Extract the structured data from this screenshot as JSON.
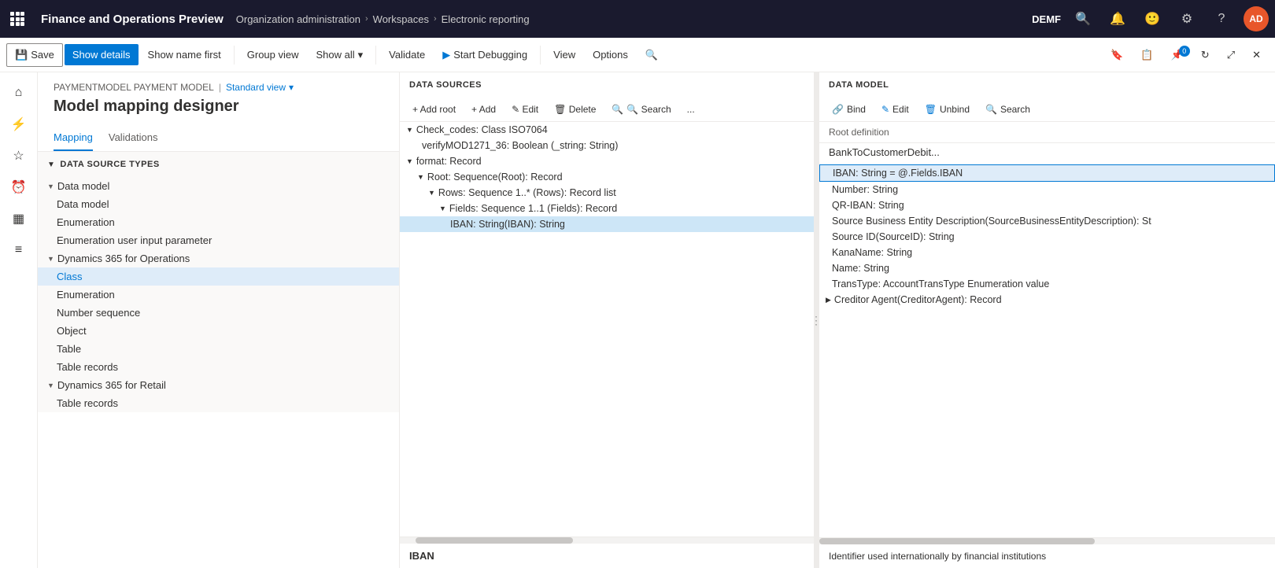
{
  "topnav": {
    "app_title": "Finance and Operations Preview",
    "breadcrumb": [
      "Organization administration",
      "Workspaces",
      "Electronic reporting"
    ],
    "env": "DEMF",
    "user_initials": "AD"
  },
  "toolbar": {
    "save_label": "Save",
    "show_details_label": "Show details",
    "show_name_first_label": "Show name first",
    "group_view_label": "Group view",
    "show_all_label": "Show all",
    "validate_label": "Validate",
    "start_debugging_label": "Start Debugging",
    "view_label": "View",
    "options_label": "Options"
  },
  "page": {
    "breadcrumb1": "PAYMENTMODEL PAYMENT MODEL",
    "breadcrumb_separator": "|",
    "standard_view": "Standard view",
    "title": "Model mapping designer"
  },
  "tabs": {
    "items": [
      "Mapping",
      "Validations"
    ]
  },
  "dst_panel": {
    "header": "DATA SOURCE TYPES",
    "items": [
      {
        "label": "Data model",
        "level": 0,
        "collapsed": false,
        "type": "parent"
      },
      {
        "label": "Data model",
        "level": 1,
        "type": "leaf"
      },
      {
        "label": "Enumeration",
        "level": 1,
        "type": "leaf"
      },
      {
        "label": "Enumeration user input parameter",
        "level": 1,
        "type": "leaf"
      },
      {
        "label": "Dynamics 365 for Operations",
        "level": 0,
        "collapsed": false,
        "type": "parent"
      },
      {
        "label": "Class",
        "level": 1,
        "type": "leaf",
        "selected": true
      },
      {
        "label": "Enumeration",
        "level": 1,
        "type": "leaf"
      },
      {
        "label": "Number sequence",
        "level": 1,
        "type": "leaf"
      },
      {
        "label": "Object",
        "level": 1,
        "type": "leaf"
      },
      {
        "label": "Table",
        "level": 1,
        "type": "leaf"
      },
      {
        "label": "Table records",
        "level": 1,
        "type": "leaf"
      },
      {
        "label": "Dynamics 365 for Retail",
        "level": 0,
        "collapsed": false,
        "type": "parent"
      },
      {
        "label": "Table records",
        "level": 1,
        "type": "leaf"
      }
    ]
  },
  "ds_panel": {
    "header": "DATA SOURCES",
    "toolbar": {
      "add_root": "+ Add root",
      "add": "+ Add",
      "edit": "✎ Edit",
      "delete": "🗑 Delete",
      "search": "🔍 Search",
      "more": "..."
    },
    "items": [
      {
        "label": "Check_codes: Class ISO7064",
        "level": 0,
        "collapsed": false,
        "arrow": "▼"
      },
      {
        "label": "verifyMOD1271_36: Boolean (_string: String)",
        "level": 1
      },
      {
        "label": "format: Record",
        "level": 0,
        "collapsed": false,
        "arrow": "▼"
      },
      {
        "label": "Root: Sequence(Root): Record",
        "level": 1,
        "collapsed": false,
        "arrow": "▼"
      },
      {
        "label": "Rows: Sequence 1..* (Rows): Record list",
        "level": 2,
        "collapsed": false,
        "arrow": "▼"
      },
      {
        "label": "Fields: Sequence 1..1 (Fields): Record",
        "level": 3,
        "collapsed": false,
        "arrow": "▼"
      },
      {
        "label": "IBAN: String(IBAN): String",
        "level": 4,
        "selected": true
      }
    ],
    "footer": "IBAN"
  },
  "dm_panel": {
    "header": "DATA MODEL",
    "toolbar": {
      "bind": "Bind",
      "edit": "Edit",
      "unbind": "Unbind",
      "search": "Search"
    },
    "root_def_label": "Root definition",
    "root_def_value": "BankToCustomerDebit...",
    "items": [
      {
        "label": "IBAN: String = @.Fields.IBAN",
        "level": 0,
        "selected": true
      },
      {
        "label": "Number: String",
        "level": 0
      },
      {
        "label": "QR-IBAN: String",
        "level": 0
      },
      {
        "label": "Source Business Entity Description(SourceBusinessEntityDescription): St",
        "level": 0
      },
      {
        "label": "Source ID(SourceID): String",
        "level": 0
      },
      {
        "label": "KanaName: String",
        "level": 0
      },
      {
        "label": "Name: String",
        "level": 0
      },
      {
        "label": "TransType: AccountTransType Enumeration value",
        "level": 0
      },
      {
        "label": "Creditor Agent(CreditorAgent): Record",
        "level": 0,
        "collapsed": true,
        "arrow": "▶"
      }
    ],
    "footer": "Identifier used internationally by financial institutions"
  }
}
